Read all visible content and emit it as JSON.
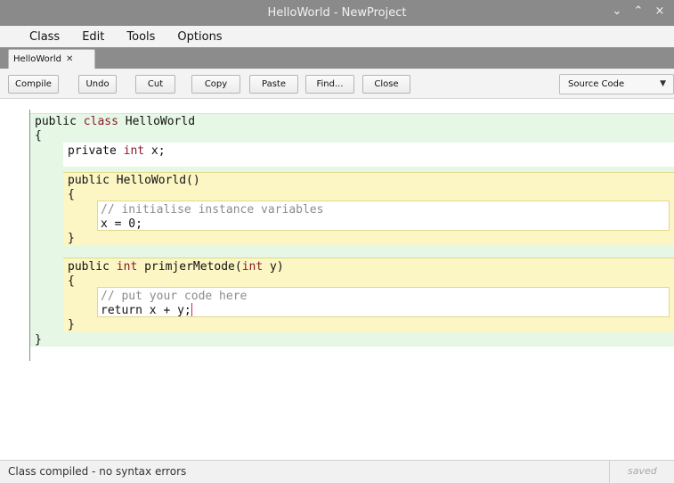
{
  "window": {
    "title": "HelloWorld - NewProject",
    "controls": {
      "minimize": "⌄",
      "maximize": "⌃",
      "close": "×"
    }
  },
  "menu": {
    "items": [
      "Class",
      "Edit",
      "Tools",
      "Options"
    ]
  },
  "tabs": [
    {
      "label": "HelloWorld",
      "close": "✕"
    }
  ],
  "toolbar": {
    "buttons": [
      "Compile",
      "Undo",
      "Cut",
      "Copy",
      "Paste",
      "Find...",
      "Close"
    ],
    "view_select": {
      "value": "Source Code",
      "chevron": "▼"
    }
  },
  "editor": {
    "lines": [
      {
        "indent": 0,
        "parts": [
          {
            "t": "public ",
            "k": "plain"
          },
          {
            "t": "class",
            "k": "kw"
          },
          {
            "t": " HelloWorld",
            "k": "plain"
          }
        ]
      },
      {
        "indent": 0,
        "parts": [
          {
            "t": "{",
            "k": "plain"
          }
        ]
      },
      {
        "indent": 1,
        "parts": [
          {
            "t": "private ",
            "k": "plain"
          },
          {
            "t": "int",
            "k": "kw"
          },
          {
            "t": " x;",
            "k": "plain"
          }
        ]
      },
      {
        "indent": 1,
        "parts": [
          {
            "t": "public HelloWorld()",
            "k": "plain"
          }
        ]
      },
      {
        "indent": 1,
        "parts": [
          {
            "t": "{",
            "k": "plain"
          }
        ]
      },
      {
        "indent": 2,
        "parts": [
          {
            "t": "// initialise instance variables",
            "k": "cm"
          }
        ]
      },
      {
        "indent": 2,
        "parts": [
          {
            "t": "x = 0;",
            "k": "plain"
          }
        ]
      },
      {
        "indent": 1,
        "parts": [
          {
            "t": "}",
            "k": "plain"
          }
        ]
      },
      {
        "indent": 1,
        "parts": [
          {
            "t": "public ",
            "k": "plain"
          },
          {
            "t": "int",
            "k": "kw"
          },
          {
            "t": " primjerMetode(",
            "k": "plain"
          },
          {
            "t": "int",
            "k": "kw"
          },
          {
            "t": " y)",
            "k": "plain"
          }
        ]
      },
      {
        "indent": 1,
        "parts": [
          {
            "t": "{",
            "k": "plain"
          }
        ]
      },
      {
        "indent": 2,
        "parts": [
          {
            "t": "// put your code here",
            "k": "cm"
          }
        ]
      },
      {
        "indent": 2,
        "parts": [
          {
            "t": "return x + y;",
            "k": "plain"
          }
        ],
        "cursor": true
      },
      {
        "indent": 1,
        "parts": [
          {
            "t": "}",
            "k": "plain"
          }
        ]
      },
      {
        "indent": 0,
        "parts": [
          {
            "t": "}",
            "k": "plain"
          }
        ]
      }
    ],
    "colors": {
      "keyword": "#8b1a2b",
      "comment": "#8c8c8c",
      "class_scope": "#e6f7e6",
      "method_scope": "#fbf6c4",
      "cursor": "#d0206a"
    }
  },
  "status": {
    "message": "Class compiled - no syntax errors",
    "saved": "saved"
  }
}
